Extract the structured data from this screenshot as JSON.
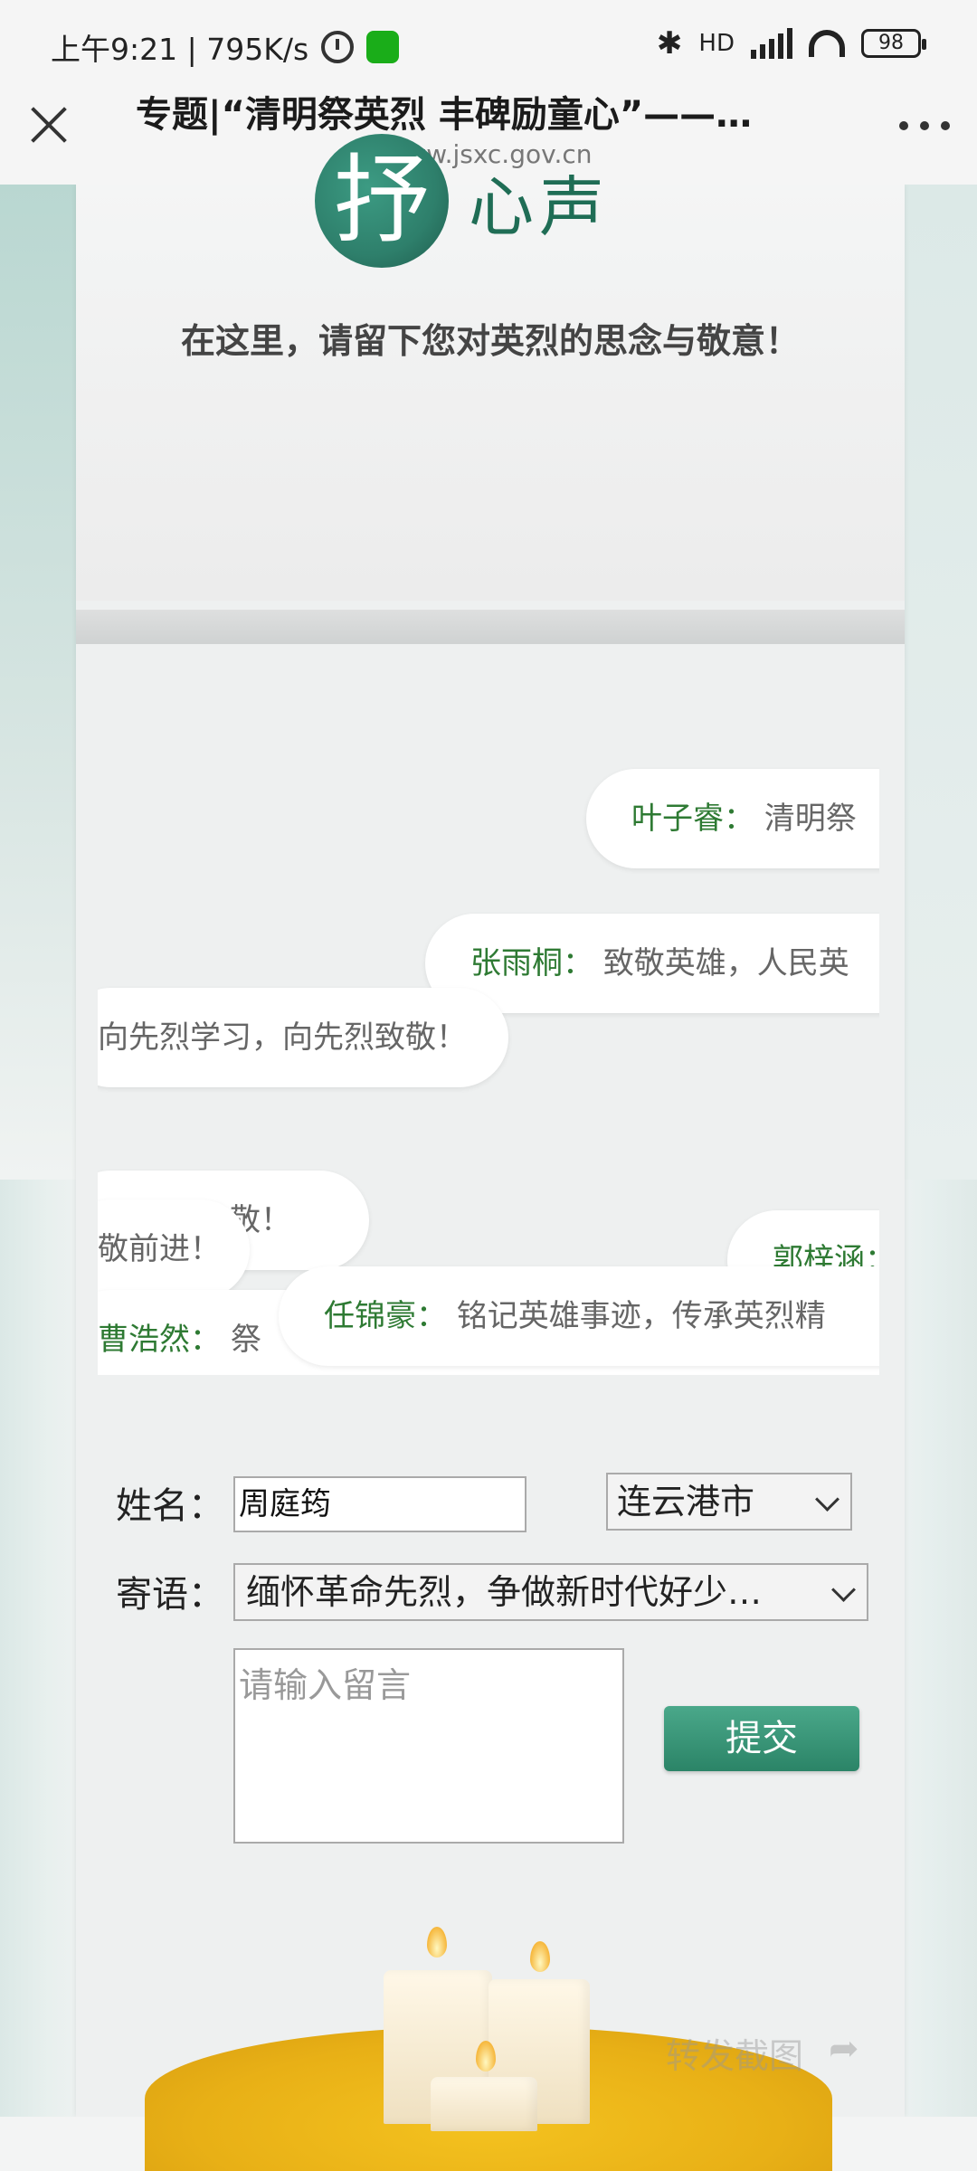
{
  "status_bar": {
    "time_speed": "上午9:21 | 795K/s",
    "network": "HD",
    "battery": "98"
  },
  "browser": {
    "title": "专题|“清明祭英烈 丰碑励童心”——…",
    "url": "www.jsxc.gov.cn"
  },
  "header": {
    "logo_char": "抒",
    "logo_text": "心声",
    "subtitle": "在这里，请留下您对英烈的思念与敬意！"
  },
  "danmu": [
    {
      "name": "叶子睿：",
      "message": "清明祭"
    },
    {
      "name": "张雨桐：",
      "message": "致敬英雄，人民英"
    },
    {
      "name": "",
      "message": "向先烈学习，向先烈致敬！"
    },
    {
      "name": "",
      "message": "向先烈致敬！"
    },
    {
      "name": "",
      "message": "敬前进！"
    },
    {
      "name": "郭梓涵：",
      "message": ""
    },
    {
      "name": "曹浩然：",
      "message": "祭"
    },
    {
      "name": "任锦豪：",
      "message": "铭记英雄事迹，传承英烈精"
    }
  ],
  "form": {
    "name_label": "姓名：",
    "name_value": "周庭筠",
    "city_value": "连云港市",
    "message_label": "寄语：",
    "message_select_value": "缅怀革命先烈，争做新时代好少…",
    "textarea_placeholder": "请输入留言",
    "submit_label": "提交"
  },
  "footer": {
    "watermark": "转发截图"
  },
  "colors": {
    "accent_green": "#2e7a33",
    "brand_teal": "#2e7f6b",
    "button_green": "#3a9a7a"
  }
}
